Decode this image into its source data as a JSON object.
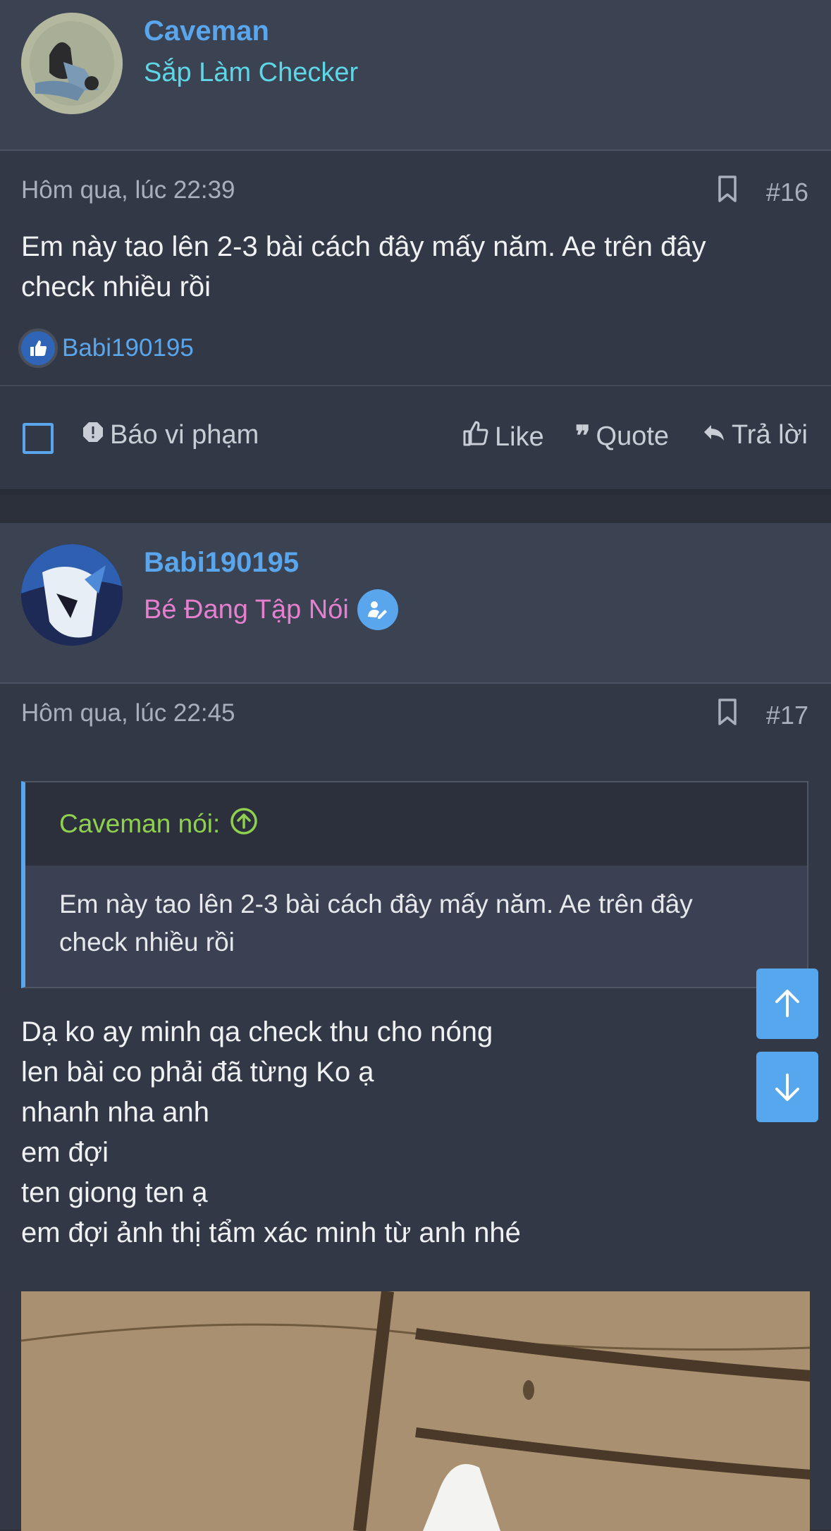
{
  "posts": [
    {
      "username": "Caveman",
      "user_title": "Sắp Làm Checker",
      "date": "Hôm qua, lúc 22:39",
      "number": "#16",
      "message_lines": [
        "Em này tao lên 2-3 bài cách đây mấy năm. Ae trên đây",
        "check nhiều rồi"
      ],
      "reaction_user": "Babi190195",
      "actions": {
        "report": "Báo vi phạm",
        "like": "Like",
        "quote": "Quote",
        "reply": "Trả lời"
      }
    },
    {
      "username": "Babi190195",
      "user_title": "Bé Đang Tập Nói",
      "date": "Hôm qua, lúc 22:45",
      "number": "#17",
      "quote": {
        "author": "Caveman nói:",
        "lines": [
          "Em này tao lên 2-3 bài cách đây mấy năm. Ae trên đây",
          "check nhiều rồi"
        ]
      },
      "message_lines": [
        "Dạ ko ay minh qa check thu cho nóng",
        "len bài co phải đã từng Ko ạ",
        "nhanh nha anh",
        "em đợi",
        "ten giong ten ạ",
        "em đợi ảnh thị tẩm xác minh từ anh nhé"
      ]
    }
  ],
  "colors": {
    "accent": "#5aa6ec",
    "title_caveman": "#5fd6e6",
    "title_babi": "#e77fcf",
    "quote_author": "#8fd14f"
  }
}
